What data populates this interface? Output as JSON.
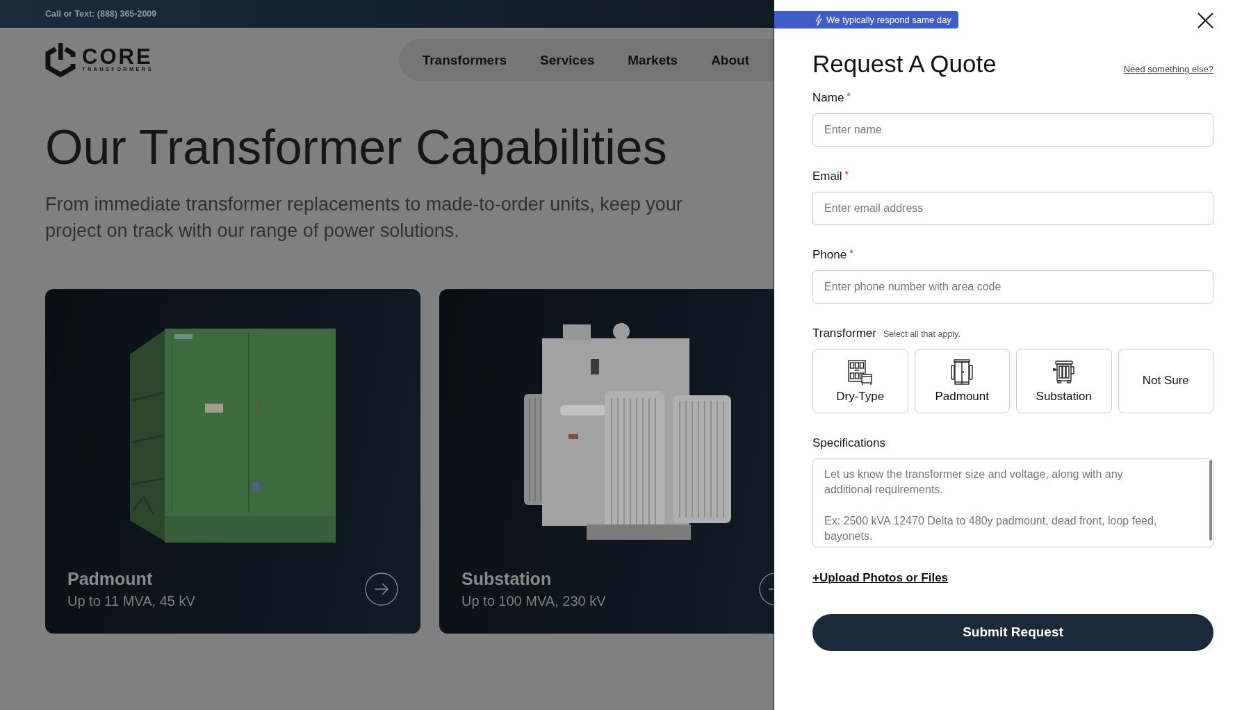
{
  "top_bar": {
    "contact": "Call or Text: (888) 365-2009"
  },
  "header": {
    "logo": {
      "name": "CORE",
      "tagline": "TRANSFORMERS"
    },
    "nav": [
      "Transformers",
      "Services",
      "Markets",
      "About"
    ]
  },
  "hero": {
    "title": "Our Transformer Capabilities",
    "subtitle": "From immediate transformer replacements to made-to-order units, keep your project on track with our range of power solutions."
  },
  "cards": [
    {
      "kind": "padmount",
      "title": "Padmount",
      "subtitle": "Up to 11 MVA, 45 kV"
    },
    {
      "kind": "substation",
      "title": "Substation",
      "subtitle": "Up to 100 MVA, 230 kV"
    }
  ],
  "quote_panel": {
    "badge": "We typically respond same day",
    "title": "Request A Quote",
    "help_link": "Need something else?",
    "fields": [
      {
        "label": "Name",
        "required_mark": "*",
        "placeholder": "Enter name"
      },
      {
        "label": "Email",
        "required_mark": "*",
        "placeholder": "Enter email address"
      },
      {
        "label": "Phone",
        "required_mark": "*",
        "placeholder": "Enter phone number with area code"
      }
    ],
    "transformer": {
      "label": "Transformer",
      "hint": "Select all that apply.",
      "options": [
        {
          "kind": "dry-type",
          "label": "Dry-Type",
          "selected": false
        },
        {
          "kind": "padmount",
          "label": "Padmount",
          "selected": false
        },
        {
          "kind": "substation",
          "label": "Substation",
          "selected": false
        },
        {
          "kind": "not-sure",
          "label": "Not Sure",
          "selected": false
        }
      ]
    },
    "specifications": {
      "label": "Specifications",
      "placeholder": "Let us know the transformer size and voltage, along with any additional requirements.\n\nEx: 2500 kVA 12470 Delta to 480y padmount, dead front, loop feed, bayonets."
    },
    "upload_link": "+Upload Photos or Files",
    "submit": "Submit Request"
  }
}
